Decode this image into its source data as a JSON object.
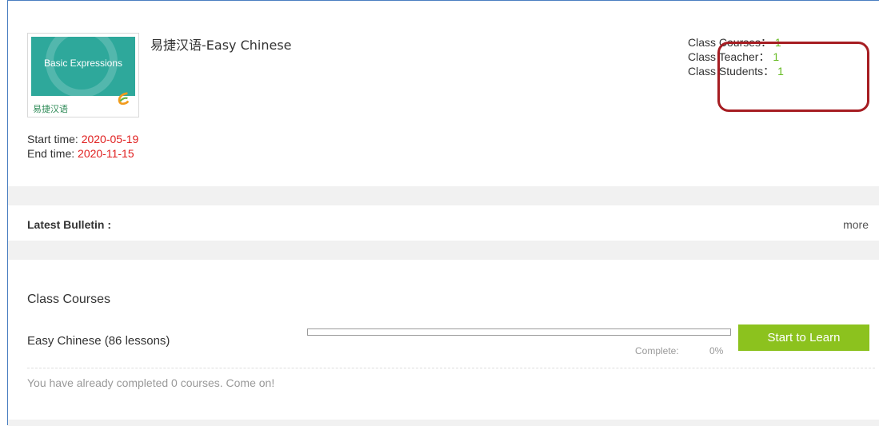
{
  "course": {
    "thumbnail_text": "Basic Expressions",
    "thumbnail_brand": "易捷汉语",
    "title": "易捷汉语-Easy Chinese"
  },
  "stats": {
    "courses_label": "Class Courses：",
    "courses_value": "1",
    "teacher_label": "Class Teacher：",
    "teacher_value": "1",
    "students_label": "Class Students：",
    "students_value": "1"
  },
  "times": {
    "start_label": "Start time:",
    "start_value": "2020-05-19",
    "end_label": "End time:",
    "end_value": "2020-11-15"
  },
  "bulletin": {
    "label": "Latest Bulletin :",
    "more": "more"
  },
  "class_courses": {
    "heading": "Class Courses",
    "items": [
      {
        "name": "Easy Chinese (86 lessons)",
        "progress_percent": 0,
        "complete_label": "Complete:",
        "complete_value": "0%",
        "button_label": "Start to Learn"
      }
    ],
    "encourage_text": "You have already completed 0 courses. Come on!"
  },
  "colors": {
    "accent_green": "#8cc21e",
    "stat_green": "#66bb22",
    "date_red": "#e02020",
    "highlight_red": "#a61d22",
    "thumbnail_teal": "#2ea89b"
  }
}
